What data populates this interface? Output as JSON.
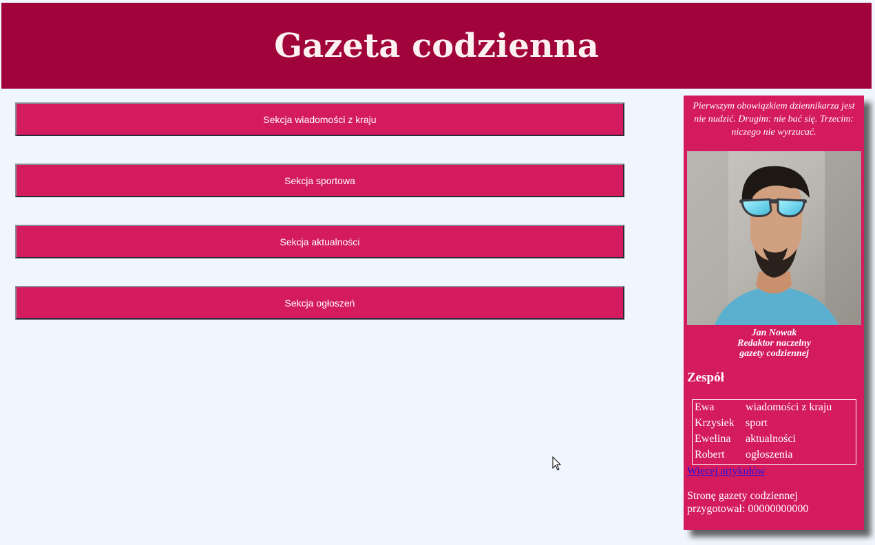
{
  "header": {
    "title": "Gazeta codzienna",
    "background": "#a0043a"
  },
  "sections": [
    {
      "label": "Sekcja wiadomości z kraju"
    },
    {
      "label": "Sekcja sportowa"
    },
    {
      "label": "Sekcja aktualności"
    },
    {
      "label": "Sekcja ogłoszeń"
    }
  ],
  "aside": {
    "background": "#d41b5e",
    "quote": "Pierwszym obowiązkiem dziennikarza jest nie nudzić. Drugim: nie bać się. Trzecim: niczego nie wyrzucać.",
    "caption": {
      "name": "Jan Nowak",
      "role": "Redaktor naczelny",
      "org": "gazety codziennej"
    },
    "team_title": "Zespół",
    "team": [
      {
        "name": "Ewa",
        "role": "wiadomości z kraju"
      },
      {
        "name": "Krzysiek",
        "role": "sport"
      },
      {
        "name": "Ewelina",
        "role": "aktualności"
      },
      {
        "name": "Robert",
        "role": "ogłoszenia"
      }
    ],
    "more_link": "Więcej artykułów",
    "footer_line1": "Stronę gazety codziennej",
    "footer_line2": "przygotował: 00000000000"
  }
}
